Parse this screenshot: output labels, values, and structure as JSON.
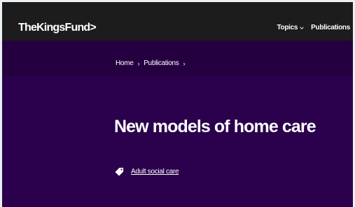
{
  "header": {
    "logo": "TheKingsFund>",
    "nav": [
      {
        "label": "Topics",
        "has_dropdown": true,
        "icon": "chevron-down-icon"
      },
      {
        "label": "Publications",
        "has_dropdown": false
      }
    ]
  },
  "breadcrumb": {
    "items": [
      "Home",
      "Publications"
    ],
    "separator": "›"
  },
  "hero": {
    "title": "New models of home care",
    "tag": {
      "label": "Adult social care",
      "icon": "tag-icon"
    }
  },
  "colors": {
    "topbar": "#1c1c1c",
    "breadcrumb_bar": "#250041",
    "hero": "#2b004c",
    "text": "#ffffff"
  }
}
